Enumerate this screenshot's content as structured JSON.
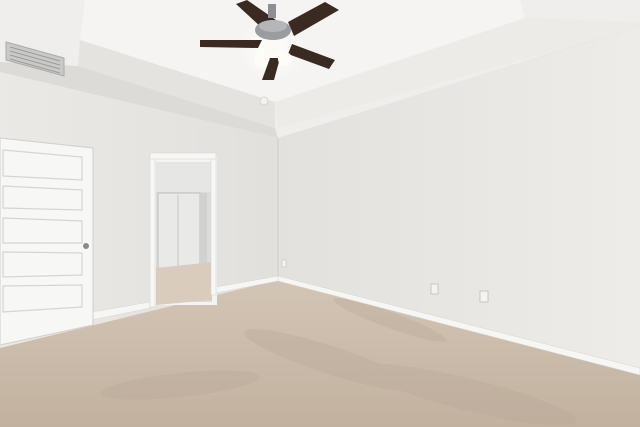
{
  "scene": {
    "colors": {
      "ceiling_outer": "#efeeec",
      "ceiling_tray": "#f4f3f1",
      "tray_face": "#e7e6e3",
      "wall_left": "#e6e4e1",
      "wall_right": "#ebe9e6",
      "carpet": "#c8b8a6",
      "carpet_dark": "#b9a897",
      "baseboard": "#f4f4f2",
      "door": "#f7f7f6",
      "door_shadow": "#d9d9d6",
      "closet_interior": "#dcdcda",
      "fan_blade": "#3b2a22",
      "fan_housing": "#8d8f92",
      "light_glass": "#fbfaf4",
      "vent": "#b9bab8"
    },
    "icons": [
      "ceiling-fan-icon",
      "air-vent-icon",
      "door-knob-icon",
      "power-outlet-icon"
    ]
  }
}
